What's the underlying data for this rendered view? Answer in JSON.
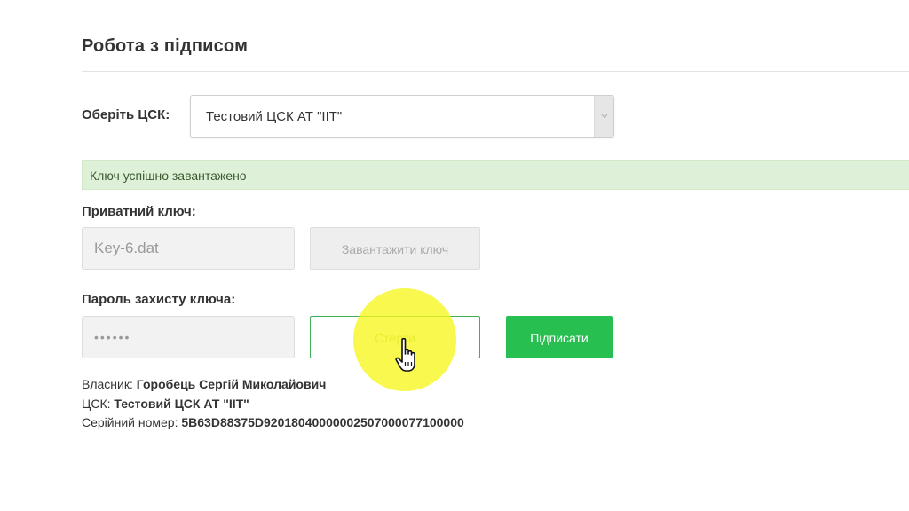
{
  "page": {
    "title": "Робота з підписом"
  },
  "ca": {
    "label": "Оберіть ЦСК:",
    "selected": "Тестовий ЦСК АТ \"ІІТ\""
  },
  "alert": {
    "text": "Ключ успішно завантажено",
    "color": "#dff0d8"
  },
  "private_key": {
    "label": "Приватний ключ:",
    "file_value": "Key-6.dat",
    "load_button": "Завантажити ключ"
  },
  "password": {
    "label": "Пароль захисту ключа:",
    "masked_value": "••••••",
    "clear_button": "Стерти",
    "sign_button": "Підписати",
    "sign_color": "#27c050"
  },
  "info": {
    "owner_label": "Власник:",
    "owner_value": "Горобець Сергій Миколайович",
    "ca_label": "ЦСК:",
    "ca_value": "Тестовий ЦСК АТ \"ІІТ\"",
    "serial_label": "Серійний номер:",
    "serial_value": "5B63D88375D92018040000002507000077100000"
  },
  "icons": {
    "select_arrow": "chevron-down-icon",
    "cursor": "hand-pointer-icon"
  }
}
